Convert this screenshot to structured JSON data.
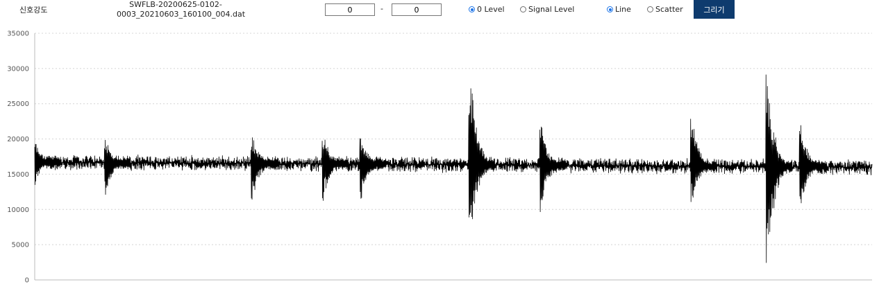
{
  "toolbar": {
    "title": "신호강도",
    "file_name": "SWFLB-20200625-0102-0003_20210603_160100_004.dat",
    "range_start": "0",
    "range_separator": "-",
    "range_end": "0",
    "level_options": [
      {
        "label": "0 Level",
        "checked": true
      },
      {
        "label": "Signal Level",
        "checked": false
      }
    ],
    "plot_options": [
      {
        "label": "Line",
        "checked": true
      },
      {
        "label": "Scatter",
        "checked": false
      }
    ],
    "draw_button": "그리기",
    "accent_color": "#0e3b6e",
    "radio_color": "#1a73e8"
  },
  "chart_data": {
    "type": "line",
    "title": "",
    "xlabel": "",
    "ylabel": "",
    "ylim": [
      0,
      35000
    ],
    "y_ticks": [
      0,
      5000,
      10000,
      15000,
      20000,
      25000,
      30000,
      35000
    ],
    "grid": "horizontal-dotted",
    "line_color": "#000000",
    "baseline_level": 16700,
    "baseline_level_right": 16000,
    "noise_amplitude": 1100,
    "series": [
      {
        "bursts": [
          {
            "position": 0.0,
            "max": 20200,
            "min": 13300
          },
          {
            "position": 0.085,
            "max": 20300,
            "min": 12000
          },
          {
            "position": 0.26,
            "max": 20700,
            "min": 10700
          },
          {
            "position": 0.345,
            "max": 21100,
            "min": 11100
          },
          {
            "position": 0.39,
            "max": 20600,
            "min": 11000
          },
          {
            "position": 0.52,
            "max": 31000,
            "min": 4300
          },
          {
            "position": 0.605,
            "max": 22200,
            "min": 9300
          },
          {
            "position": 0.785,
            "max": 24000,
            "min": 10600
          },
          {
            "position": 0.875,
            "max": 30600,
            "min": 0
          },
          {
            "position": 0.915,
            "max": 22600,
            "min": 10200
          }
        ]
      }
    ]
  }
}
